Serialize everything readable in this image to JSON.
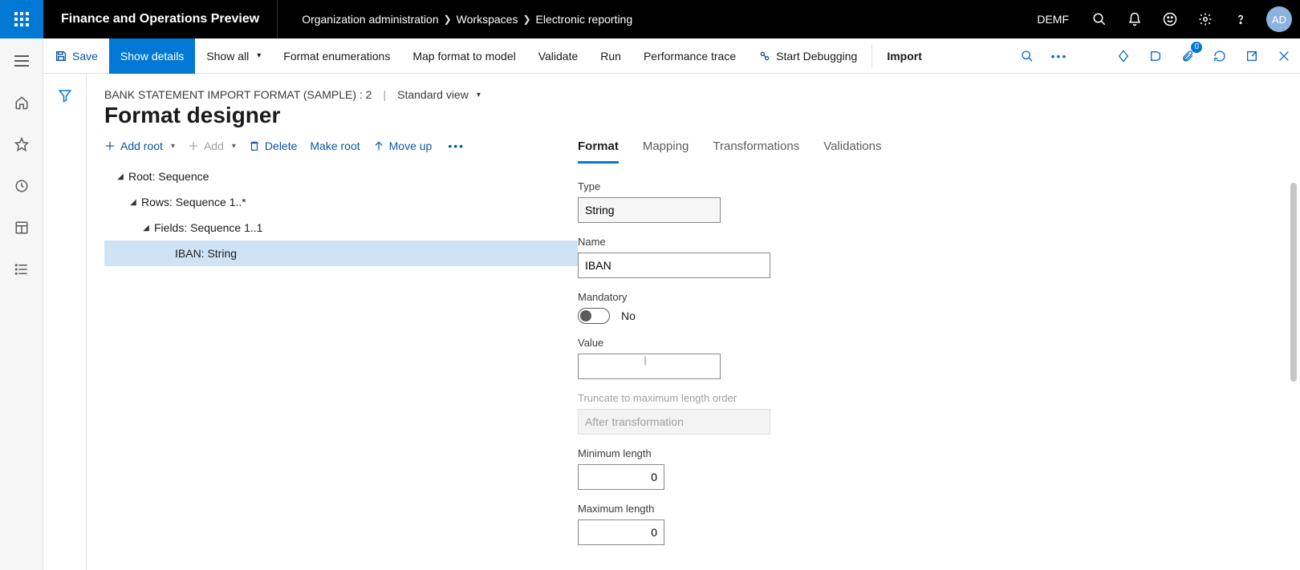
{
  "top": {
    "app_title": "Finance and Operations Preview",
    "breadcrumbs": [
      "Organization administration",
      "Workspaces",
      "Electronic reporting"
    ],
    "entity": "DEMF",
    "avatar": "AD"
  },
  "actions": {
    "save": "Save",
    "show_details": "Show details",
    "show_all": "Show all",
    "format_enum": "Format enumerations",
    "map_format": "Map format to model",
    "validate": "Validate",
    "run": "Run",
    "perf_trace": "Performance trace",
    "start_debug": "Start Debugging",
    "import": "Import",
    "attach_badge": "0"
  },
  "header": {
    "path": "BANK STATEMENT IMPORT FORMAT (SAMPLE) : 2",
    "view": "Standard view",
    "title": "Format designer"
  },
  "toolbar": {
    "add_root": "Add root",
    "add": "Add",
    "delete": "Delete",
    "make_root": "Make root",
    "move_up": "Move up"
  },
  "tree": {
    "n0": "Root: Sequence",
    "n1": "Rows: Sequence 1..*",
    "n2": "Fields: Sequence 1..1",
    "n3": "IBAN: String"
  },
  "tabs": {
    "t0": "Format",
    "t1": "Mapping",
    "t2": "Transformations",
    "t3": "Validations"
  },
  "form": {
    "type_label": "Type",
    "type_value": "String",
    "name_label": "Name",
    "name_value": "IBAN",
    "mandatory_label": "Mandatory",
    "mandatory_value": "No",
    "value_label": "Value",
    "value_value": "",
    "trunc_label": "Truncate to maximum length order",
    "trunc_value": "After transformation",
    "min_label": "Minimum length",
    "min_value": "0",
    "max_label": "Maximum length",
    "max_value": "0"
  }
}
